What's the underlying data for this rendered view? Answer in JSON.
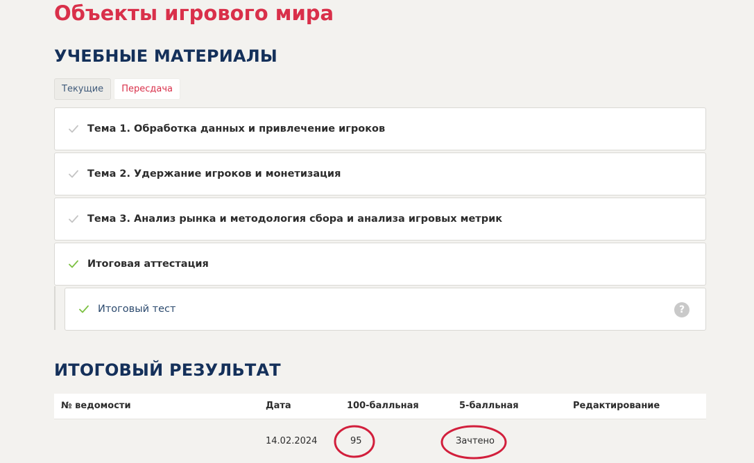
{
  "course": {
    "title": "Объекты игрового мира"
  },
  "materials": {
    "title": "УЧЕБНЫЕ МАТЕРИАЛЫ",
    "tabs": [
      {
        "label": "Текущие",
        "active": false
      },
      {
        "label": "Пересдача",
        "active": true
      }
    ],
    "topics": [
      {
        "label": "Тема 1. Обработка данных и привлечение игроков",
        "check_color": "#c4c4c4"
      },
      {
        "label": "Тема 2. Удержание игроков и монетизация",
        "check_color": "#c4c4c4"
      },
      {
        "label": "Тема 3. Анализ рынка и методология сбора и анализа игровых метрик",
        "check_color": "#c4c4c4"
      },
      {
        "label": "Итоговая аттестация",
        "check_color": "#7cc142"
      }
    ],
    "subitem": {
      "label": "Итоговый тест",
      "check_color": "#7cc142",
      "help_icon": "?"
    }
  },
  "results": {
    "title": "ИТОГОВЫЙ РЕЗУЛЬТАТ",
    "columns": [
      "№ ведомости",
      "Дата",
      "100-балльная",
      "5-балльная",
      "Редактирование"
    ],
    "rows": [
      {
        "sheet": "",
        "date": "14.02.2024",
        "score100": "95",
        "score5": "Зачтено",
        "edit": ""
      }
    ],
    "annotation_color": "#d21f3c"
  },
  "colors": {
    "accent": "#d9304a",
    "heading": "#14305a",
    "success": "#7cc142",
    "muted_check": "#c4c4c4"
  }
}
